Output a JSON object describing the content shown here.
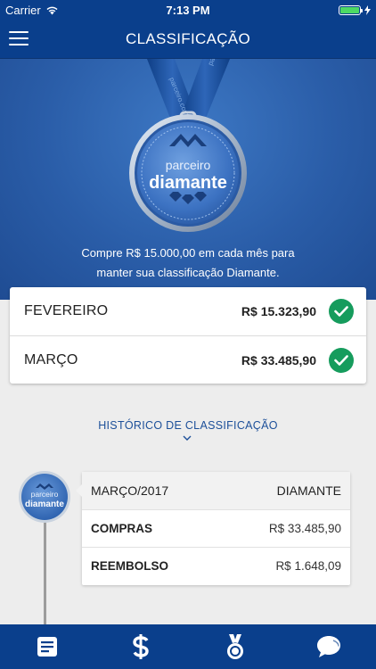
{
  "status_bar": {
    "carrier": "Carrier",
    "time": "7:13 PM"
  },
  "nav": {
    "title": "CLASSIFICAÇÃO"
  },
  "medal": {
    "ribbon_text": "parceiro.com",
    "line1": "parceiro",
    "line2": "diamante",
    "badge_line1": "parceiro",
    "badge_line2": "diamante"
  },
  "hero": {
    "line1": "Compre R$ 15.000,00 em cada mês para",
    "line2": "manter sua classificação Diamante."
  },
  "months": [
    {
      "name": "FEVEREIRO",
      "value": "R$ 15.323,90"
    },
    {
      "name": "MARÇO",
      "value": "R$ 33.485,90"
    }
  ],
  "history": {
    "title": "HISTÓRICO DE CLASSIFICAÇÃO",
    "period": "MARÇO/2017",
    "level": "DIAMANTE",
    "rows": [
      {
        "label": "COMPRAS",
        "value": "R$ 33.485,90"
      },
      {
        "label": "REEMBOLSO",
        "value": "R$ 1.648,09"
      }
    ]
  },
  "colors": {
    "primary": "#0a3f8c",
    "success": "#169c5d",
    "link": "#1c4f99"
  },
  "tabs": [
    "document-icon",
    "dollar-icon",
    "medal-icon",
    "chat-icon"
  ]
}
